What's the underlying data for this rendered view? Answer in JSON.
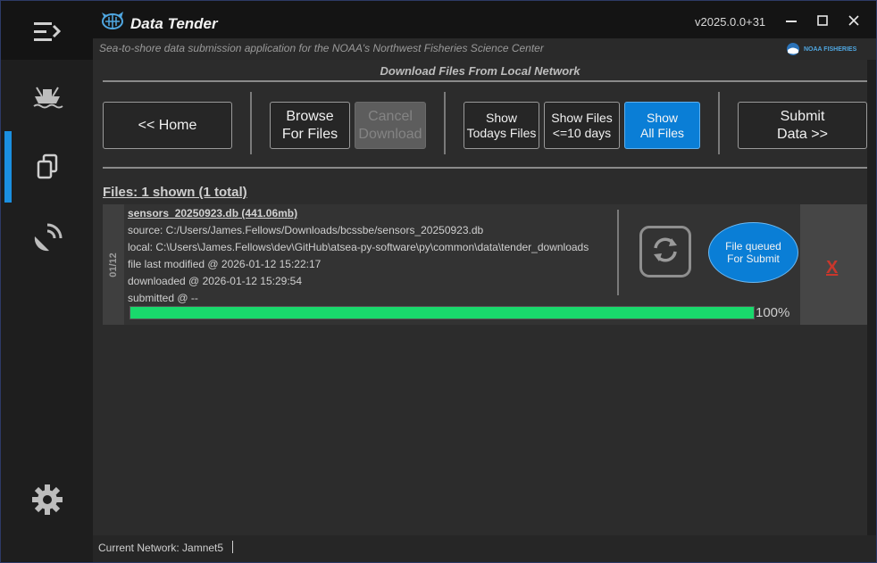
{
  "app": {
    "title": "Data Tender",
    "version": "v2025.0.0+31",
    "subtitle": "Sea-to-shore data submission application for the NOAA's Northwest Fisheries Science Center",
    "noaa_logo_text": "NOAA FISHERIES"
  },
  "nav": {
    "items": [
      {
        "name": "menu-toggle",
        "icon": "hamburger-arrow-icon"
      },
      {
        "name": "vessel",
        "icon": "ship-icon"
      },
      {
        "name": "files",
        "icon": "copy-files-icon",
        "active": true
      },
      {
        "name": "satellite",
        "icon": "satellite-icon"
      },
      {
        "name": "settings",
        "icon": "gear-icon"
      }
    ]
  },
  "page": {
    "section_title": "Download Files From Local Network",
    "buttons": {
      "home": "<< Home",
      "browse_1": "Browse",
      "browse_2": "For Files",
      "cancel_1": "Cancel",
      "cancel_2": "Download",
      "today_1": "Show",
      "today_2": "Todays Files",
      "ten_1": "Show Files",
      "ten_2": "<=10 days",
      "all_1": "Show",
      "all_2": "All Files",
      "submit_1": "Submit",
      "submit_2": "Data >>"
    },
    "files_count": "Files: 1 shown (1 total)"
  },
  "file": {
    "date_tab": "01/12",
    "name": "sensors_20250923.db (441.06mb)",
    "source": "source: C:/Users/James.Fellows/Downloads/bcssbe/sensors_20250923.db",
    "local": "local: C:\\Users\\James.Fellows\\dev\\GitHub\\atsea-py-software\\py\\common\\data\\tender_downloads",
    "modified": "file last modified @ 2026-01-12 15:22:17",
    "downloaded": "downloaded @ 2026-01-12 15:29:54",
    "submitted": "submitted @ --",
    "status_1": "File queued",
    "status_2": "For Submit",
    "delete": "X",
    "progress": 1.0,
    "progress_text": "100%"
  },
  "statusbar": {
    "network": "Current Network: Jamnet5"
  },
  "colors": {
    "accent_blue": "#0a7ed6",
    "progress_green": "#19d96c",
    "delete_red": "#c9372c"
  }
}
